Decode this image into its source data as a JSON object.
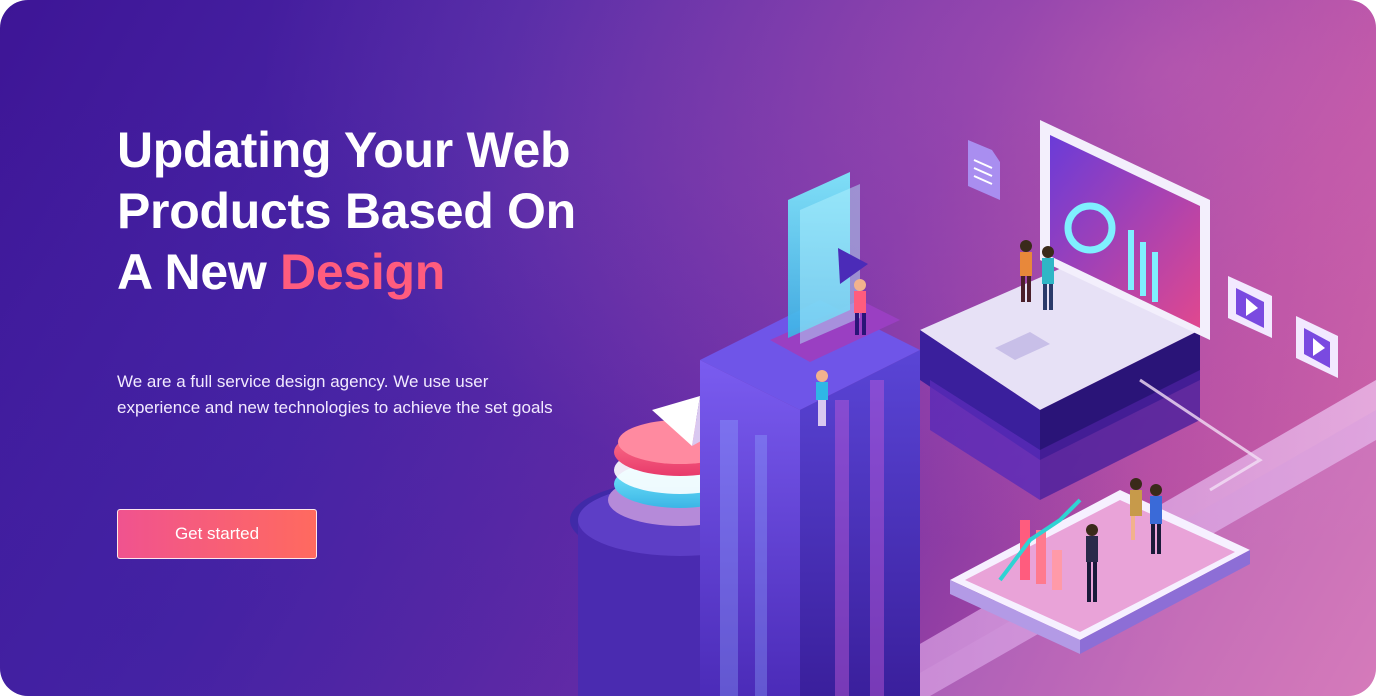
{
  "hero": {
    "title_line1": "Updating Your Web",
    "title_line2": "Products Based On",
    "title_line3_prefix": "A New ",
    "title_line3_accent": "Design",
    "description": "We are a full service design agency. We use user experience and new technologies to achieve the set goals",
    "cta_label": "Get started"
  },
  "colors": {
    "accent": "#ff5c7e",
    "button_start": "#f0538f",
    "button_end": "#ff6a5f",
    "bg_start": "#3d1596",
    "bg_end": "#d66aa6"
  }
}
